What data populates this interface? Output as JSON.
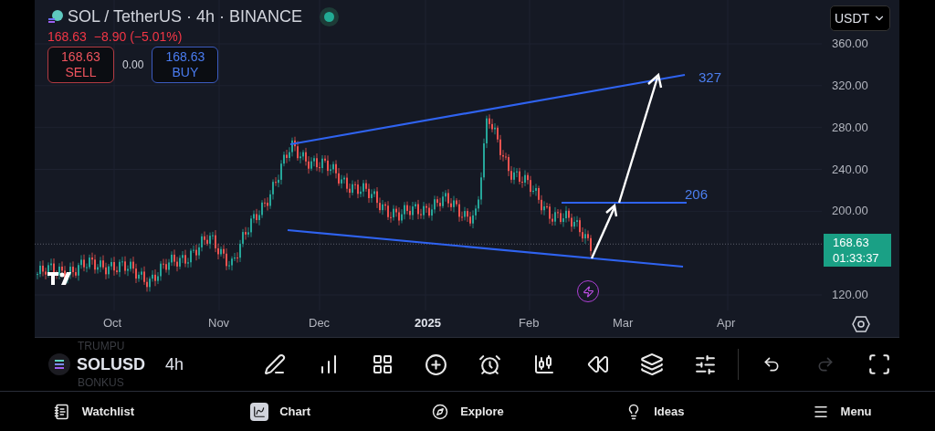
{
  "header": {
    "symbol": "SOL / TetherUS · 4h · BINANCE",
    "market_open": true,
    "last": "168.63",
    "change": "−8.90 (−5.01%)"
  },
  "trade": {
    "sell_price": "168.63",
    "sell_label": "SELL",
    "spread": "0.00",
    "buy_price": "168.63",
    "buy_label": "BUY"
  },
  "currency": "USDT",
  "price_axis": {
    "ticks": [
      "360.00",
      "320.00",
      "280.00",
      "240.00",
      "200.00",
      "120.00"
    ],
    "current_price": "168.63",
    "countdown": "01:33:37"
  },
  "time_axis": [
    {
      "label": "Oct",
      "bold": false
    },
    {
      "label": "Nov",
      "bold": false
    },
    {
      "label": "Dec",
      "bold": false
    },
    {
      "label": "2025",
      "bold": true
    },
    {
      "label": "Feb",
      "bold": false
    },
    {
      "label": "Mar",
      "bold": false
    },
    {
      "label": "Apr",
      "bold": false
    }
  ],
  "targets": [
    {
      "label": "327"
    },
    {
      "label": "206"
    }
  ],
  "symbol_picker": {
    "above": "TRUMPU",
    "current": "SOLUSD",
    "below": "BONKUS"
  },
  "interval": "4h",
  "history": [
    {
      "kind": "undo",
      "disabled": false
    },
    {
      "kind": "redo",
      "disabled": true
    }
  ],
  "nav": [
    {
      "label": "Watchlist",
      "selected": false
    },
    {
      "label": "Chart",
      "selected": true
    },
    {
      "label": "Explore",
      "selected": false
    },
    {
      "label": "Ideas",
      "selected": false
    },
    {
      "label": "Menu",
      "selected": false
    }
  ]
}
